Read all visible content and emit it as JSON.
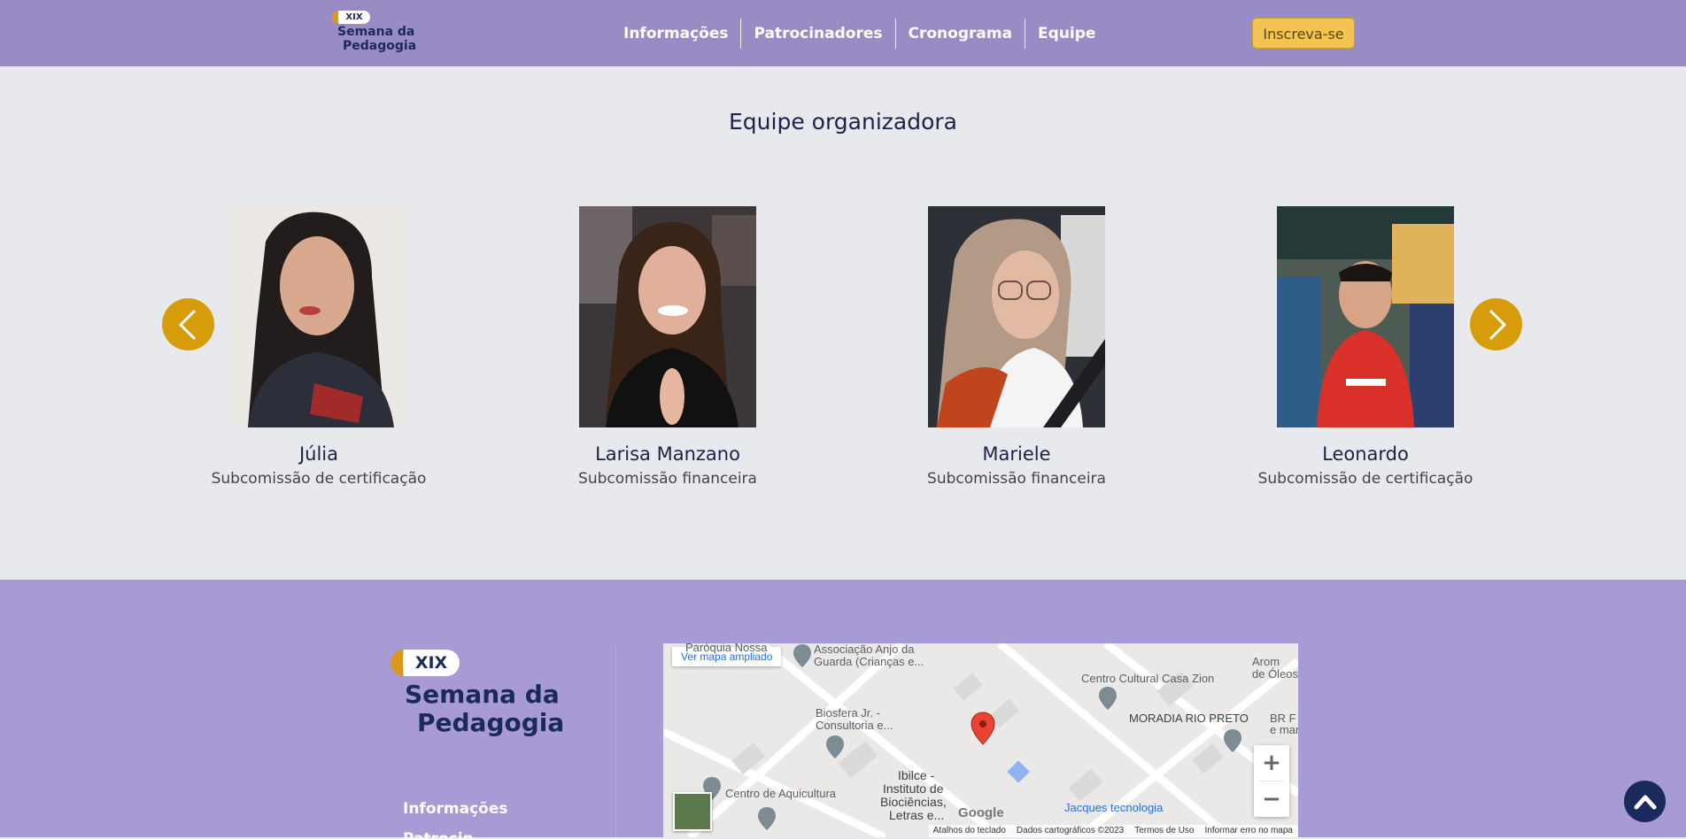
{
  "header": {
    "logo": {
      "badge": "XIX",
      "line1": "Semana da",
      "line2": "Pedagogia"
    },
    "nav": [
      "Informações",
      "Patrocinadores",
      "Cronograma",
      "Equipe"
    ],
    "cta": "Inscreva-se",
    "bg_color": "#998cc4"
  },
  "team": {
    "title": "Equipe organizadora",
    "members": [
      {
        "name": "Júlia",
        "role": "Subcomissão de certificação"
      },
      {
        "name": "Larisa Manzano",
        "role": "Subcomissão financeira"
      },
      {
        "name": "Mariele",
        "role": "Subcomissão financeira"
      },
      {
        "name": "Leonardo",
        "role": "Subcomissão de certificação"
      }
    ],
    "prev_icon": "chevron-left-icon",
    "next_icon": "chevron-right-icon",
    "arrow_color": "#d79c0a"
  },
  "footer": {
    "logo": {
      "badge": "XIX",
      "line1": "Semana da",
      "line2": "Pedagogia"
    },
    "links": [
      "Informações",
      "Patrocinadores"
    ],
    "bg_color": "#a79ad5"
  },
  "map": {
    "open_larger": "Ver mapa ampliado",
    "labels": [
      "Paróquia Nossa",
      "Associação Anjo da",
      "Guarda (Crianças e...",
      "Centro Cultural Casa Zion",
      "Arom",
      "de Óleos",
      "MORADIA RIO PRETO",
      "BR F",
      "e manu",
      "Biosfera Jr. -",
      "Consultoria e...",
      "Centro de Aquicultura",
      "Ibilce -",
      "Instituto de",
      "Biociências,",
      "Letras e...",
      "Jacques tecnologia"
    ],
    "google": "Google",
    "footer": [
      "Atalhos do teclado",
      "Dados cartográficos ©2023",
      "Termos de Uso",
      "Informar erro no mapa"
    ],
    "zoom_in": "+",
    "zoom_out": "−"
  },
  "back_to_top_icon": "chevron-up-icon"
}
